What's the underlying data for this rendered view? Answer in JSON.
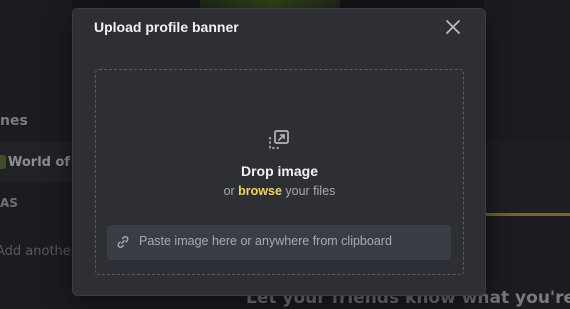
{
  "background": {
    "section_heading": "nes",
    "game_name": "World of W",
    "sub_label": "AS",
    "add_text": "Add another",
    "bottom_text": "Let your friends know what you're"
  },
  "modal": {
    "title": "Upload profile banner",
    "close_icon": "close-icon",
    "dropzone": {
      "icon": "image-upload-icon",
      "title": "Drop image",
      "subtitle_prefix": "or ",
      "browse_label": "browse",
      "subtitle_suffix": " your files"
    },
    "paste_field": {
      "icon": "link-icon",
      "placeholder": "Paste image here or anywhere from clipboard"
    }
  },
  "colors": {
    "accent": "#f0d264",
    "modal_bg": "#2d2f35",
    "field_bg": "#3b3d44"
  }
}
